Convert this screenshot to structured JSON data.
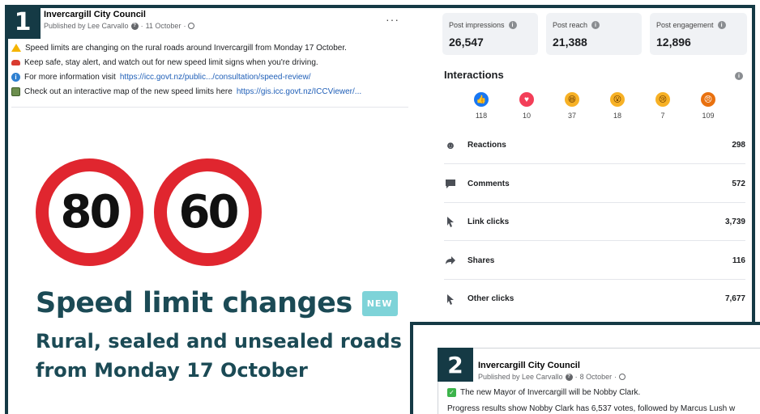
{
  "post1": {
    "badge": "1",
    "page_name": "Invercargill City Council",
    "published_by": "Published by Lee Carvallo",
    "date": "11 October",
    "more": "···",
    "lines": [
      {
        "icon": "warning-icon",
        "text": "Speed limits are changing on the rural roads around Invercargill from Monday 17 October.",
        "link": ""
      },
      {
        "icon": "car-icon",
        "text": "Keep safe, stay alert, and watch out for new speed limit signs when you're driving.",
        "link": ""
      },
      {
        "icon": "info-icon",
        "text": "For more information visit",
        "link": "https://icc.govt.nz/public.../consultation/speed-review/"
      },
      {
        "icon": "map-icon",
        "text": "Check out an interactive map of the new speed limits here",
        "link": "https://gis.icc.govt.nz/ICCViewer/..."
      }
    ],
    "sign_left": "80",
    "sign_right": "60",
    "headline": "Speed limit changes",
    "new_badge": "NEW",
    "sub_line1": "Rural, sealed and unsealed roads",
    "sub_line2": "from Monday 17 October"
  },
  "insights": {
    "metrics": [
      {
        "label": "Post impressions",
        "value": "26,547"
      },
      {
        "label": "Post reach",
        "value": "21,388"
      },
      {
        "label": "Post engagement",
        "value": "12,896"
      }
    ],
    "interactions_title": "Interactions",
    "reactions": [
      {
        "icon": "like-icon",
        "color": "#1877f2",
        "count": "118"
      },
      {
        "icon": "love-icon",
        "color": "#f33e58",
        "count": "10"
      },
      {
        "icon": "haha-icon",
        "color": "#f7b125",
        "count": "37"
      },
      {
        "icon": "wow-icon",
        "color": "#f7b125",
        "count": "18"
      },
      {
        "icon": "sad-icon",
        "color": "#f7b125",
        "count": "7"
      },
      {
        "icon": "angry-icon",
        "color": "#e9710f",
        "count": "109"
      }
    ],
    "stats": [
      {
        "icon": "smiley-icon",
        "label": "Reactions",
        "value": "298"
      },
      {
        "icon": "comment-icon",
        "label": "Comments",
        "value": "572"
      },
      {
        "icon": "cursor-icon",
        "label": "Link clicks",
        "value": "3,739"
      },
      {
        "icon": "share-icon",
        "label": "Shares",
        "value": "116"
      },
      {
        "icon": "cursor-icon",
        "label": "Other clicks",
        "value": "7,677"
      }
    ]
  },
  "post2": {
    "badge": "2",
    "page_name": "Invercargill City Council",
    "published_by": "Published by Lee Carvallo",
    "date": "8 October",
    "line1": "The new Mayor of Invercargill will be Nobby Clark.",
    "line2": "Progress results show Nobby Clark has 6,537 votes, followed by Marcus Lush w"
  }
}
